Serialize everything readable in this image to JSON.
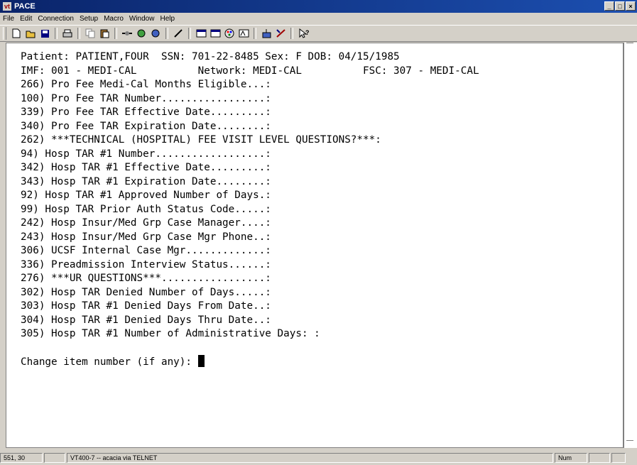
{
  "window": {
    "title": "PACE",
    "app_icon_text": "vt"
  },
  "menu": [
    "File",
    "Edit",
    "Connection",
    "Setup",
    "Macro",
    "Window",
    "Help"
  ],
  "toolbar_icons": [
    "new-icon",
    "open-icon",
    "save-icon",
    "print-icon",
    "copy-icon",
    "paste-icon",
    "connect-icon",
    "disconnect-icon",
    "reconnect-icon",
    "keymap-icon",
    "settings-icon",
    "settings2-icon",
    "colors-icon",
    "fonts-icon",
    "transfer-icon",
    "macro-icon",
    "help-icon"
  ],
  "terminal": {
    "lines": [
      "Patient: PATIENT,FOUR  SSN: 701-22-8485 Sex: F DOB: 04/15/1985",
      "IMF: 001 - MEDI-CAL          Network: MEDI-CAL          FSC: 307 - MEDI-CAL",
      "266) Pro Fee Medi-Cal Months Eligible...:",
      "100) Pro Fee TAR Number.................:",
      "339) Pro Fee TAR Effective Date.........:",
      "340) Pro Fee TAR Expiration Date........:",
      "262) ***TECHNICAL (HOSPITAL) FEE VISIT LEVEL QUESTIONS?***:",
      "94) Hosp TAR #1 Number..................:",
      "342) Hosp TAR #1 Effective Date.........:",
      "343) Hosp TAR #1 Expiration Date........:",
      "92) Hosp TAR #1 Approved Number of Days.:",
      "99) Hosp TAR Prior Auth Status Code.....:",
      "242) Hosp Insur/Med Grp Case Manager....:",
      "243) Hosp Insur/Med Grp Case Mgr Phone..:",
      "306) UCSF Internal Case Mgr.............:",
      "336) Preadmission Interview Status......:",
      "276) ***UR QUESTIONS***.................:",
      "302) Hosp TAR Denied Number of Days.....:",
      "303) Hosp TAR #1 Denied Days From Date..:",
      "304) Hosp TAR #1 Denied Days Thru Date..:",
      "305) Hosp TAR #1 Number of Administrative Days: :",
      "",
      "Change item number (if any): "
    ]
  },
  "status": {
    "position": "551, 30",
    "connection": "VT400-7 -- acacia via TELNET",
    "num": "Num"
  }
}
